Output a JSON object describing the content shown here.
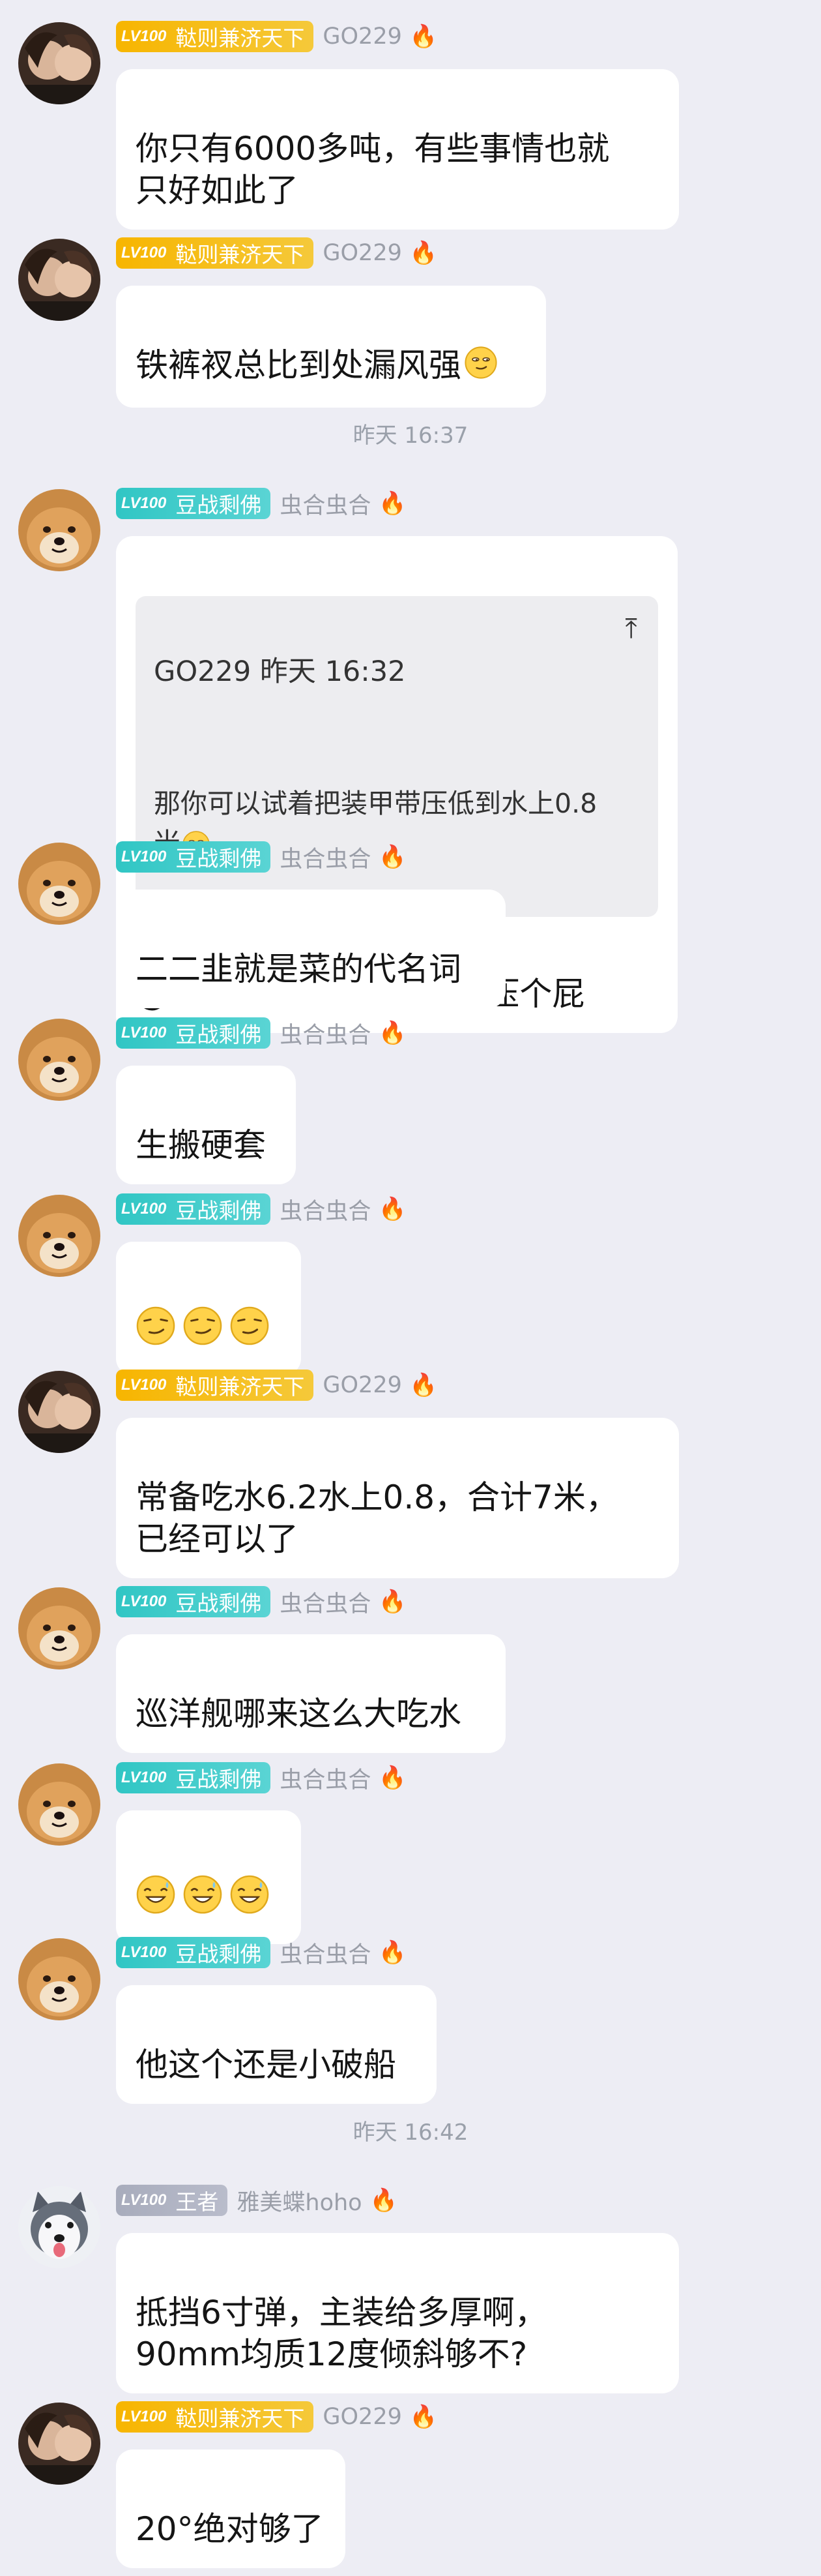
{
  "icons": {
    "fire": "fire-icon",
    "quote_jump": "jump-to-original-icon"
  },
  "colors": {
    "badge_gold": "#f7b500",
    "badge_teal": "#30c6c4",
    "badge_gray": "#a8acbc",
    "background": "#ededf4"
  },
  "timestamps": [
    "昨天 16:37",
    "昨天 16:42"
  ],
  "messages": [
    {
      "badge_level": "LV100",
      "badge_title": "鞑则兼济天下",
      "nickname": "GO229",
      "text": "你只有6000多吨，有些事情也就\n只好如此了"
    },
    {
      "badge_level": "LV100",
      "badge_title": "鞑则兼济天下",
      "nickname": "GO229",
      "text": "铁裤衩总比到处漏风强"
    },
    {
      "badge_level": "LV100",
      "badge_title": "豆战剩佛",
      "nickname": "虫合虫合",
      "quote_header": "GO229 昨天 16:32",
      "quote_text": "那你可以试着把装甲带压低到水上0.8\n米",
      "text": "@GO229 他这个吃水能压个屁"
    },
    {
      "badge_level": "LV100",
      "badge_title": "豆战剩佛",
      "nickname": "虫合虫合",
      "text": "二二韭就是菜的代名词"
    },
    {
      "badge_level": "LV100",
      "badge_title": "豆战剩佛",
      "nickname": "虫合虫合",
      "text": "生搬硬套"
    },
    {
      "badge_level": "LV100",
      "badge_title": "豆战剩佛",
      "nickname": "虫合虫合",
      "text": ""
    },
    {
      "badge_level": "LV100",
      "badge_title": "鞑则兼济天下",
      "nickname": "GO229",
      "text": "常备吃水6.2水上0.8，合计7米，\n已经可以了"
    },
    {
      "badge_level": "LV100",
      "badge_title": "豆战剩佛",
      "nickname": "虫合虫合",
      "text": "巡洋舰哪来这么大吃水"
    },
    {
      "badge_level": "LV100",
      "badge_title": "豆战剩佛",
      "nickname": "虫合虫合",
      "text": ""
    },
    {
      "badge_level": "LV100",
      "badge_title": "豆战剩佛",
      "nickname": "虫合虫合",
      "text": "他这个还是小破船"
    },
    {
      "badge_level": "LV100",
      "badge_title": "王者",
      "nickname": "雅美蝶hoho",
      "text": "抵挡6寸弹，主装给多厚啊，\n90mm均质12度倾斜够不?"
    },
    {
      "badge_level": "LV100",
      "badge_title": "鞑则兼济天下",
      "nickname": "GO229",
      "text": "20°绝对够了"
    }
  ]
}
